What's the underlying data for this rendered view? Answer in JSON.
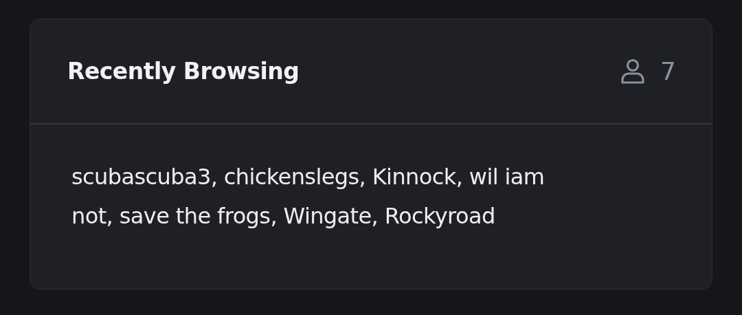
{
  "card": {
    "title": "Recently Browsing",
    "viewer_count": "7",
    "users_text": "scubascuba3, chickenslegs, Kinnock, wil iam not, save the frogs, Wingate, Rockyroad"
  }
}
